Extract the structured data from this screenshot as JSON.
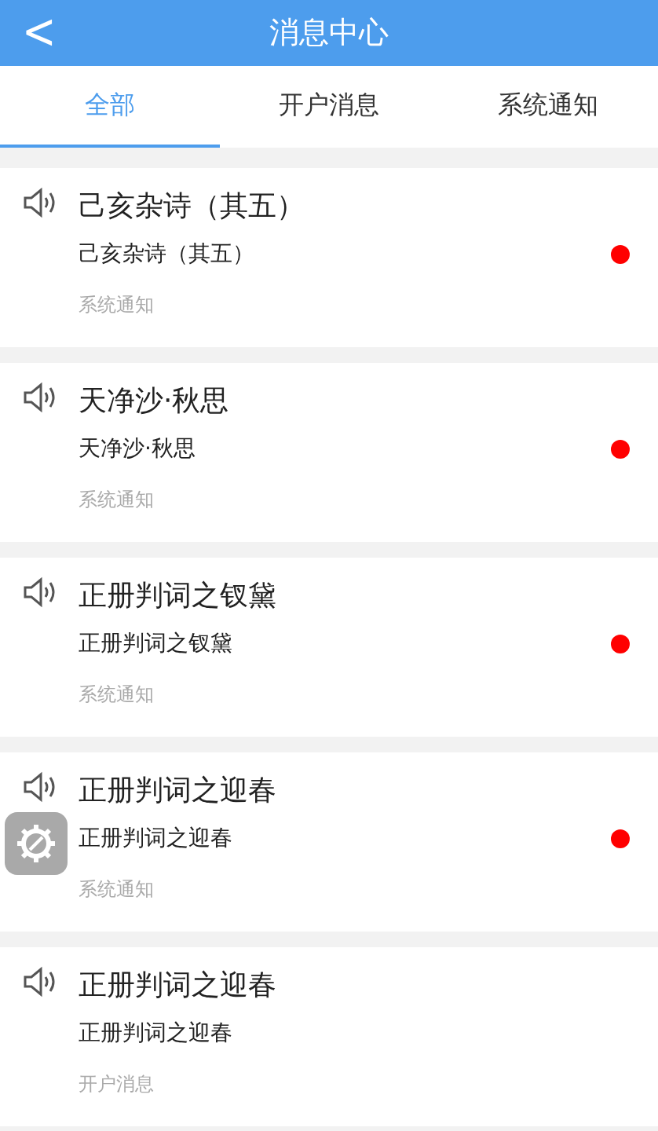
{
  "header": {
    "back_icon": "<",
    "title": "消息中心"
  },
  "tabs": [
    {
      "label": "全部",
      "selected": true
    },
    {
      "label": "开户消息",
      "selected": false
    },
    {
      "label": "系统通知",
      "selected": false
    }
  ],
  "messages": [
    {
      "title": "己亥杂诗（其五）",
      "summary": "己亥杂诗（其五）",
      "category": "系统通知",
      "unread": true
    },
    {
      "title": "天净沙·秋思",
      "summary": "天净沙·秋思",
      "category": "系统通知",
      "unread": true
    },
    {
      "title": "正册判词之钗黛",
      "summary": "正册判词之钗黛",
      "category": "系统通知",
      "unread": true
    },
    {
      "title": "正册判词之迎春",
      "summary": "正册判词之迎春",
      "category": "系统通知",
      "unread": true
    },
    {
      "title": "正册判词之迎春",
      "summary": "正册判词之迎春",
      "category": "开户消息",
      "unread": false
    }
  ],
  "floating_button": {
    "kind": "settings"
  }
}
